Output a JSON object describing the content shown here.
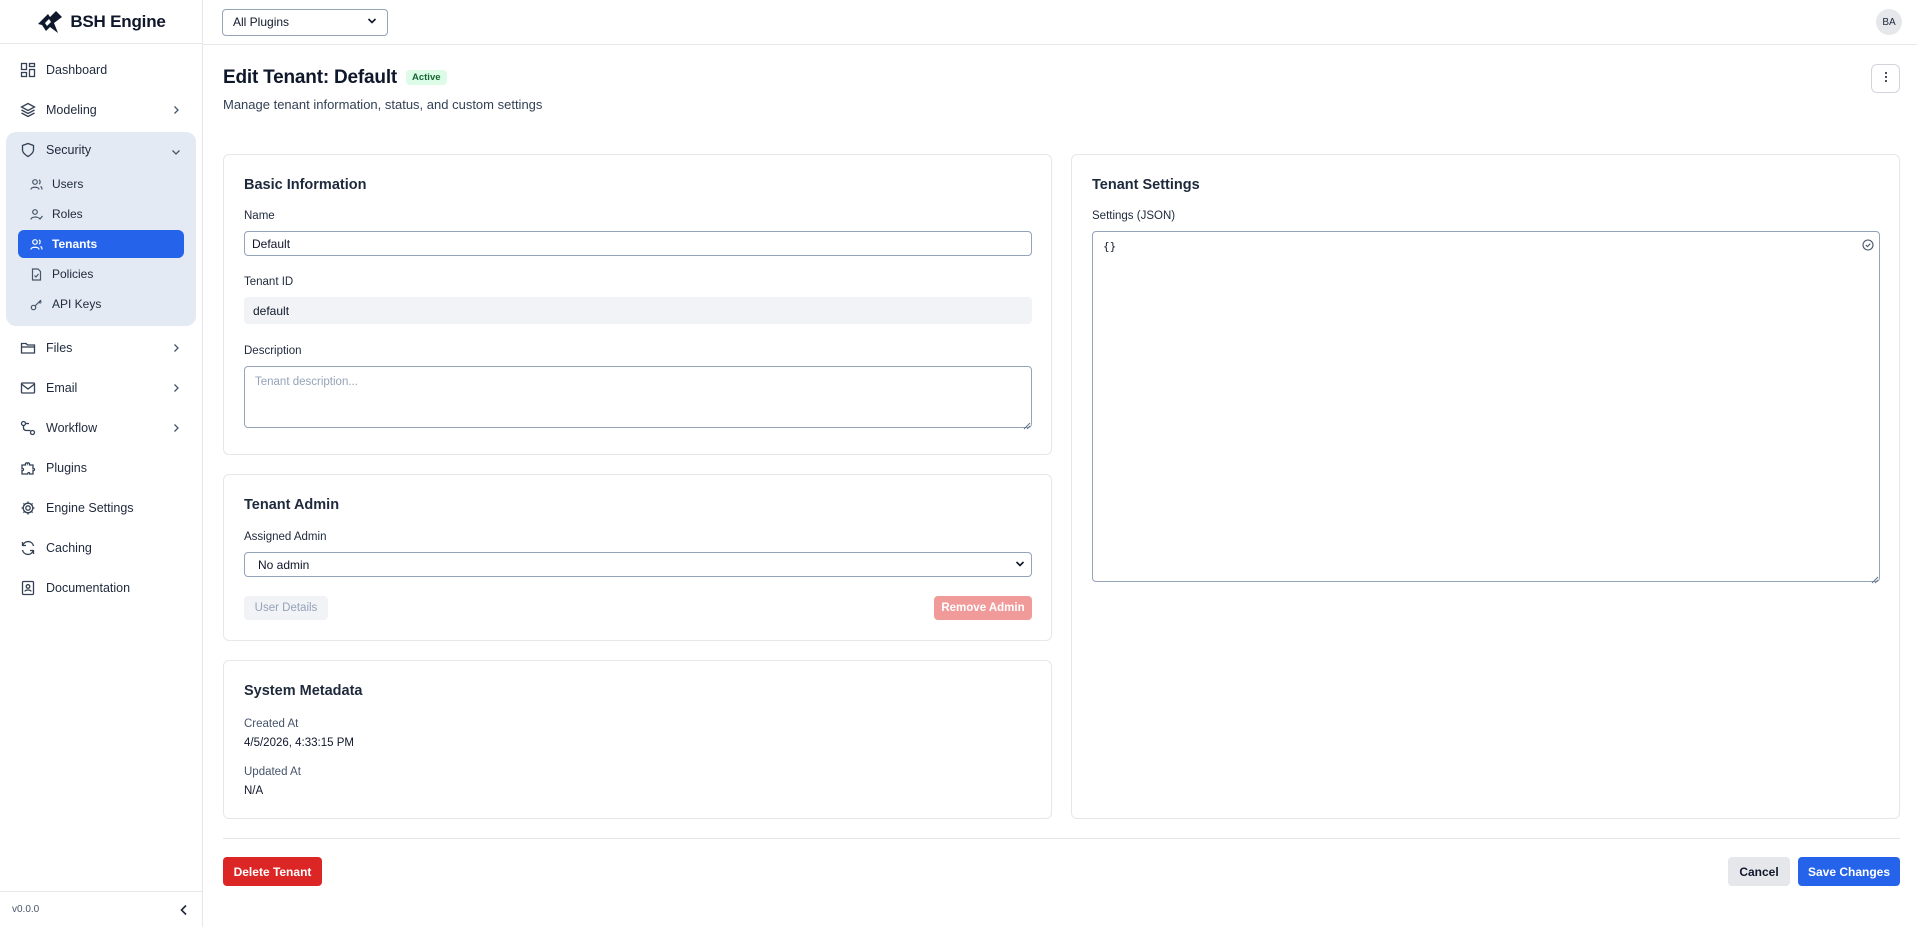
{
  "brand": {
    "name": "BSH Engine"
  },
  "sidebar": {
    "items": [
      {
        "label": "Dashboard"
      },
      {
        "label": "Modeling"
      },
      {
        "label": "Security"
      },
      {
        "label": "Files"
      },
      {
        "label": "Email"
      },
      {
        "label": "Workflow"
      },
      {
        "label": "Plugins"
      },
      {
        "label": "Engine Settings"
      },
      {
        "label": "Caching"
      },
      {
        "label": "Documentation"
      }
    ],
    "security_sub": [
      {
        "label": "Users"
      },
      {
        "label": "Roles"
      },
      {
        "label": "Tenants"
      },
      {
        "label": "Policies"
      },
      {
        "label": "API Keys"
      }
    ],
    "active_item": "Tenants",
    "version": "v0.0.0"
  },
  "topbar": {
    "plugin_select_value": "All Plugins",
    "avatar_initials": "BA"
  },
  "page": {
    "title": "Edit Tenant: Default",
    "status": "Active",
    "subtitle": "Manage tenant information, status, and custom settings"
  },
  "basic_info": {
    "title": "Basic Information",
    "name_label": "Name",
    "name_value": "Default",
    "tenant_id_label": "Tenant ID",
    "tenant_id_value": "default",
    "description_label": "Description",
    "description_placeholder": "Tenant description..."
  },
  "tenant_admin": {
    "title": "Tenant Admin",
    "assigned_label": "Assigned Admin",
    "assigned_value": "No admin",
    "user_details_label": "User Details",
    "remove_admin_label": "Remove Admin"
  },
  "system_metadata": {
    "title": "System Metadata",
    "created_label": "Created At",
    "created_value": "4/5/2026, 4:33:15 PM",
    "updated_label": "Updated At",
    "updated_value": "N/A"
  },
  "tenant_settings": {
    "title": "Tenant Settings",
    "settings_label": "Settings (JSON)",
    "settings_value": "{}"
  },
  "actions": {
    "delete_label": "Delete Tenant",
    "cancel_label": "Cancel",
    "save_label": "Save Changes"
  },
  "colors": {
    "primary": "#2563eb",
    "danger": "#dc2626",
    "danger_muted": "#f09a9a",
    "success_bg": "#dcfce7",
    "success_text": "#166534"
  }
}
